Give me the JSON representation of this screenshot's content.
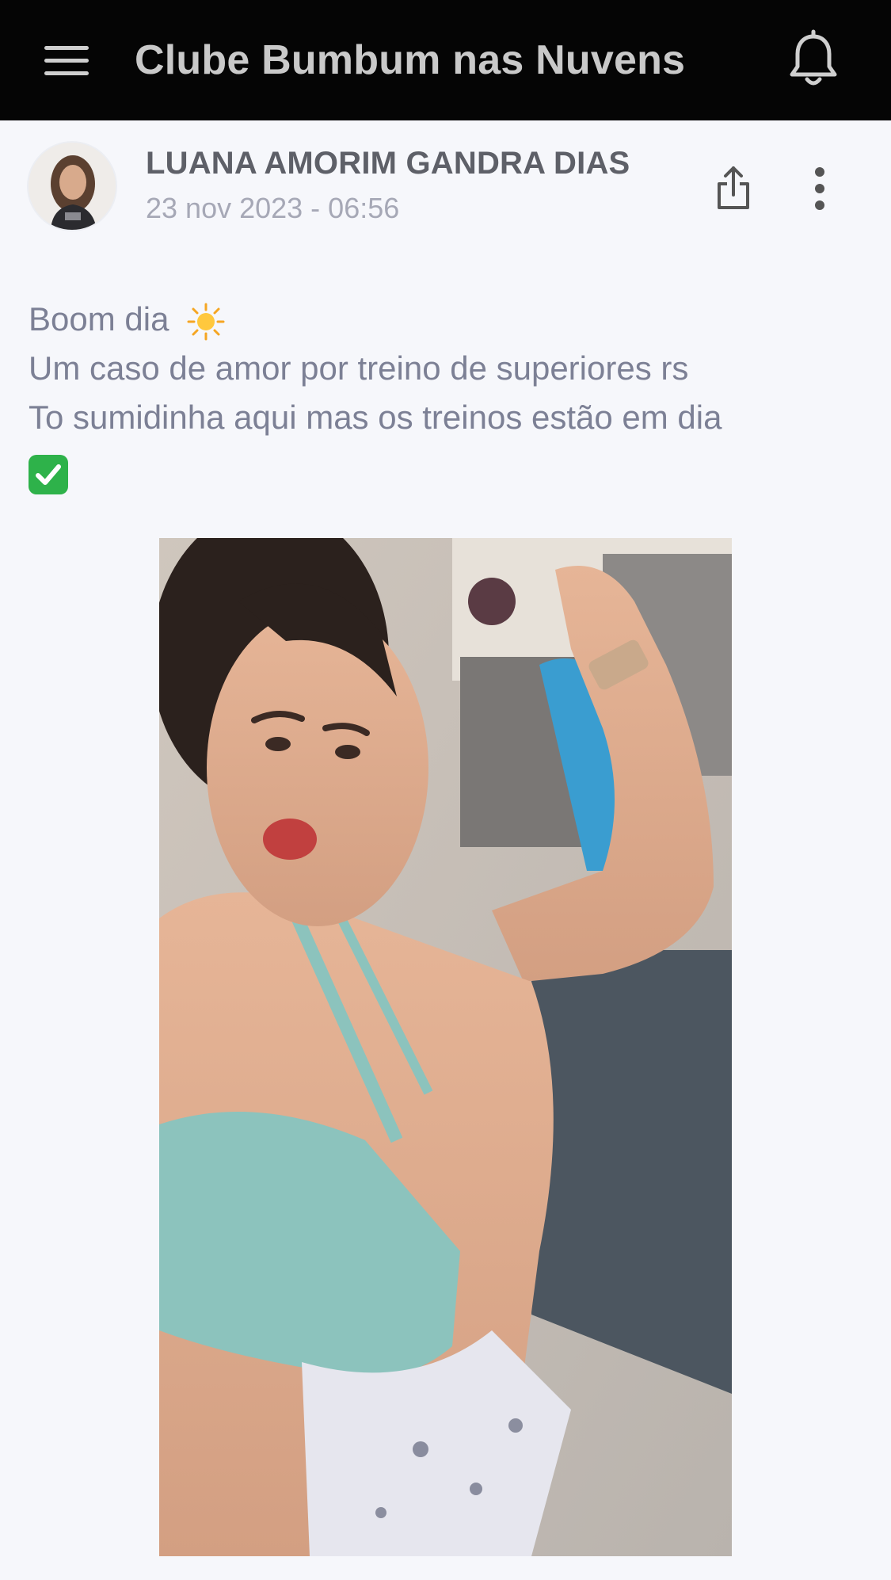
{
  "header": {
    "title": "Clube Bumbum nas Nuvens",
    "menu_icon": "menu-icon",
    "notification_icon": "bell-icon"
  },
  "post": {
    "author": "LUANA AMORIM GANDRA DIAS",
    "date": "23 nov 2023 - 06:56",
    "share_icon": "share-icon",
    "more_icon": "more-vertical-icon",
    "lines": [
      "Boom dia",
      "Um caso de amor por treino de superiores rs",
      "To sumidinha aqui mas os treinos estão em dia"
    ],
    "emojis": [
      "sun-emoji",
      "check-mark-emoji"
    ]
  },
  "colors": {
    "header_bg": "#050505",
    "page_bg": "#f6f7fb",
    "author_text": "#5e6068",
    "date_text": "#a6a8b6",
    "body_text": "#7c8095",
    "check_green": "#2eb24a"
  }
}
